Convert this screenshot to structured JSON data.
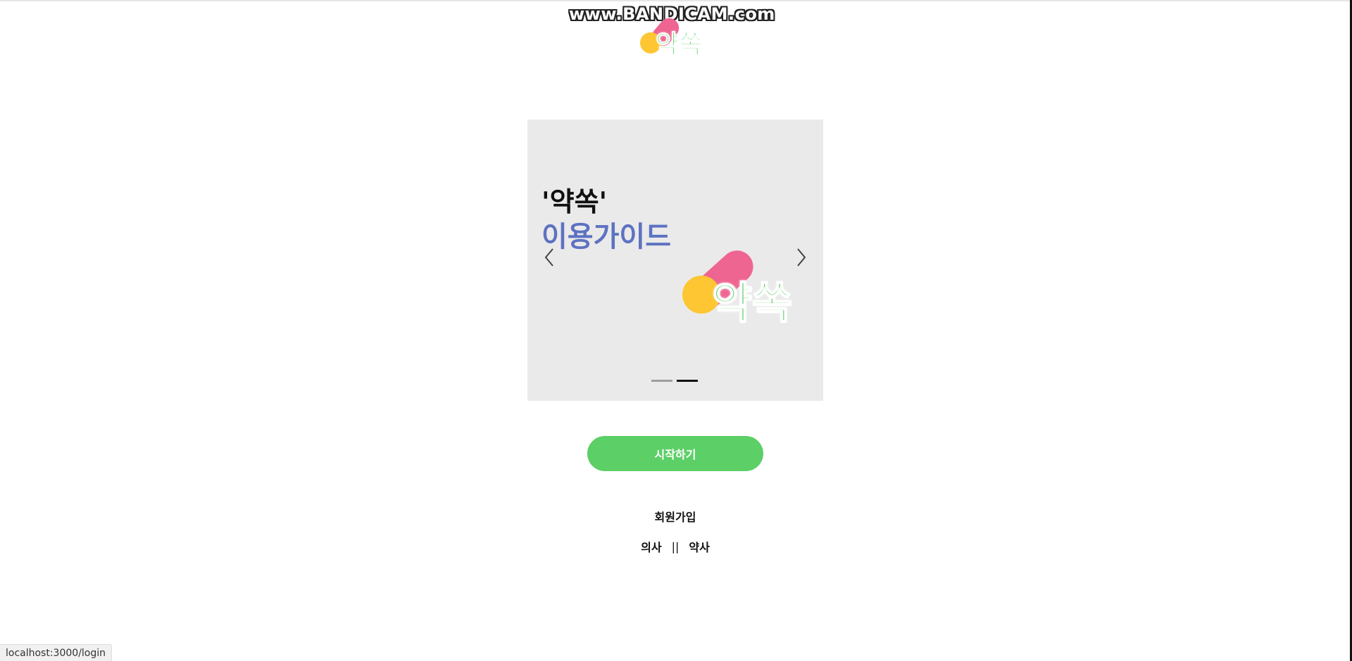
{
  "watermark": "www.BANDICAM.com",
  "header": {
    "logo_text": "약쏙"
  },
  "carousel": {
    "title_line1": "'약쏙'",
    "title_line2": "이용가이드",
    "logo_text": "약쏙",
    "prev_icon": "chevron-left-icon",
    "next_icon": "chevron-right-icon",
    "slide_count": 2,
    "active_index": 1
  },
  "start_button": {
    "label": "시작하기",
    "color": "#5ccf66"
  },
  "signup": {
    "label": "회원가입",
    "doctor": "의사",
    "separator": "||",
    "pharmacist": "약사"
  },
  "status_bar": {
    "url": "localhost:3000/login"
  },
  "colors": {
    "brand_green": "#58cc60",
    "brand_pink": "#ef6592",
    "brand_yellow": "#fdc632",
    "guide_blue": "#5d73c2"
  }
}
